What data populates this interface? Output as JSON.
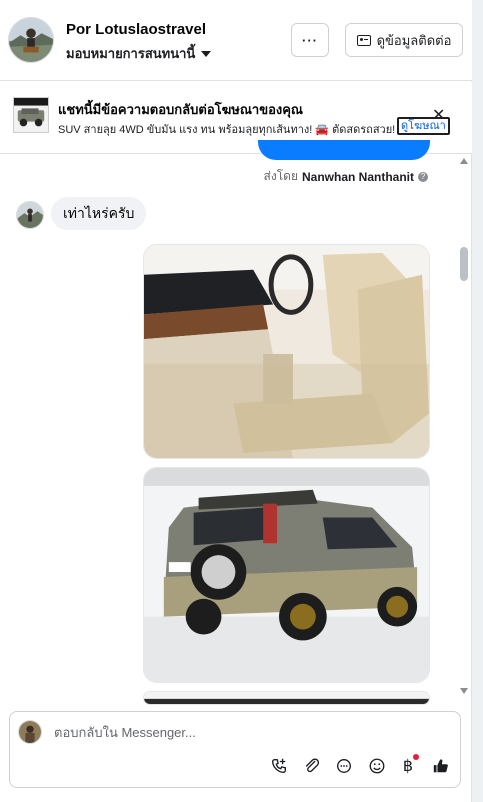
{
  "header": {
    "page_name": "Por Lotuslaostravel",
    "assigned_label": "มอบหมายการสนทนานี้",
    "more_label": "···",
    "contact_label": "ดูข้อมูลติดต่อ"
  },
  "ad_banner": {
    "title": "แชทนี้มีข้อความตอบกลับต่อโฆษณาของคุณ",
    "description": "SUV สายลุย 4WD ขับมัน แรง ทน พร้อมลุยทุกเส้นทาง! 🚘 ตัดสดรถสวย! E...",
    "link_label": "ดูโฆษณา",
    "close_label": "✕"
  },
  "messages": {
    "sent_by_prefix": "ส่งโดย",
    "sent_by_name": "Nanwhan Nanthanit",
    "sent_by_info": "?",
    "incoming_text": "เท่าไหร่ครับ"
  },
  "composer": {
    "placeholder": "ตอบกลับใน Messenger...",
    "currency_symbol": "฿"
  },
  "colors": {
    "accent": "#0a7cff",
    "link": "#0a5fd8",
    "notification": "#e41e3f"
  },
  "icons": [
    "phone-plus-icon",
    "attach-icon",
    "chat-icon",
    "emoji-icon",
    "baht-icon",
    "thumbs-up-icon",
    "dots-icon",
    "contact-card-icon",
    "close-icon",
    "caret-down-icon"
  ]
}
